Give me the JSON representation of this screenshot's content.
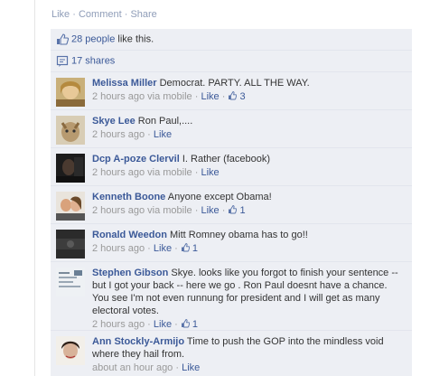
{
  "actions": {
    "like": "Like",
    "sep1": " · ",
    "comment": "Comment",
    "sep2": " · ",
    "share": "Share"
  },
  "summary": {
    "likes_count": "28 people",
    "likes_suffix": " like this.",
    "shares": "17 shares"
  },
  "comments": [
    {
      "author": "Melissa Miller",
      "text": " Democrat. PARTY. ALL THE WAY.",
      "time": "2 hours ago via mobile",
      "like": "Like",
      "likes": "3"
    },
    {
      "author": "Skye Lee",
      "text": " Ron Paul,....",
      "time": "2 hours ago",
      "like": "Like",
      "likes": ""
    },
    {
      "author": "Dcp A-poze Clervil",
      "text": " I. Rather (facebook)",
      "time": "2 hours ago via mobile",
      "like": "Like",
      "likes": ""
    },
    {
      "author": "Kenneth Boone",
      "text": " Anyone except Obama!",
      "time": "2 hours ago via mobile",
      "like": "Like",
      "likes": "1"
    },
    {
      "author": "Ronald Weedon",
      "text": " Mitt Romney obama has to go!!",
      "time": "2 hours ago",
      "like": "Like",
      "likes": "1"
    },
    {
      "author": "Stephen Gibson",
      "text": " Skye. looks like you forgot to finish your sentence -- but I got your back -- here we go . Ron Paul doesnt have a chance. You see I'm not even runnung for president and I will get as many electoral votes.",
      "time": "2 hours ago",
      "like": "Like",
      "likes": "1"
    },
    {
      "author": "Ann Stockly-Armijo",
      "text": " Time to push the GOP into the mindless void where they hail from.",
      "time": "about an hour ago",
      "like": "Like",
      "likes": ""
    }
  ],
  "dot": " · ",
  "colors": {
    "link": "#3b5998",
    "panel": "#edeff4",
    "meta": "#999999"
  }
}
